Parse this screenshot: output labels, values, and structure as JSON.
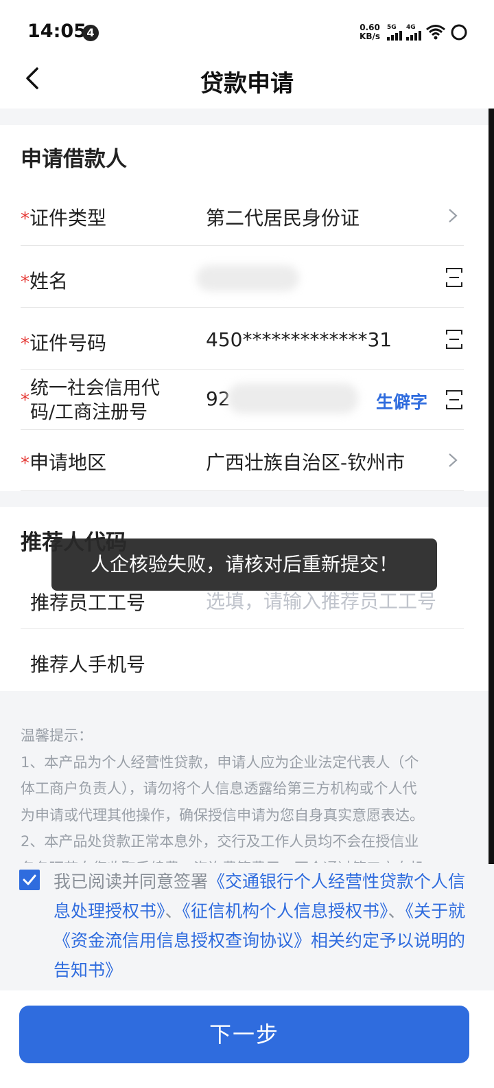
{
  "status_bar": {
    "time": "14:05",
    "notification_count": "4",
    "net_speed_value": "0.60",
    "net_speed_unit": "KB/s",
    "signal1_label": "5G",
    "signal2_label": "4G"
  },
  "header": {
    "title": "贷款申请"
  },
  "borrower": {
    "section_title": "申请借款人",
    "rows": [
      {
        "label": "证件类型",
        "value": "第二代居民身份证"
      },
      {
        "label": "姓名",
        "value": ""
      },
      {
        "label": "证件号码",
        "value": "450*************31"
      },
      {
        "label_line1": "统一社会信用代",
        "label_line2": "码/工商注册号",
        "value": "92",
        "link": "生僻字"
      },
      {
        "label": "申请地区",
        "value": "广西壮族自治区-钦州市"
      }
    ],
    "required_mark": "*"
  },
  "referrer": {
    "section_title": "推荐人代码",
    "rows": [
      {
        "label": "推荐员工工号",
        "placeholder": "选填，请输入推荐员工工号"
      },
      {
        "label": "推荐人手机号"
      }
    ]
  },
  "tips": {
    "heading": "温馨提示：",
    "lines": [
      "1、本产品为个人经营性贷款，申请人应为企业法定代表人（个",
      "体工商户负责人），请勿将个人信息透露给第三方机构或个人代",
      "为申请或代理其他操作，确保授信申请为您自身真实意愿表达。",
      "2、本产品处贷款正常本息外，交行及工作人员均不会在授信业",
      "务各环节向您收取手续费、咨询费等费用，不会通过第三方向机"
    ]
  },
  "agreement": {
    "prefix": "我已阅读并同意签署",
    "doc1": "《交通银行个人经营性贷款个人信息处理授权书》",
    "sep1": "、",
    "doc2": "《征信机构个人信息授权书》",
    "sep2": "、",
    "doc3": "《关于就《资金流信用信息授权查询协议》相关约定予以说明的告知书》"
  },
  "footer": {
    "next_label": "下一步"
  },
  "toast": {
    "message": "人企核验失败，请核对后重新提交！"
  },
  "colors": {
    "accent": "#2f6cde",
    "required": "#e53935",
    "toast_bg": "#282828"
  },
  "icons": [
    "back-arrow-icon",
    "chevron-right-icon",
    "scan-icon",
    "checkbox-checked-icon",
    "wifi-icon",
    "ring-icon"
  ]
}
